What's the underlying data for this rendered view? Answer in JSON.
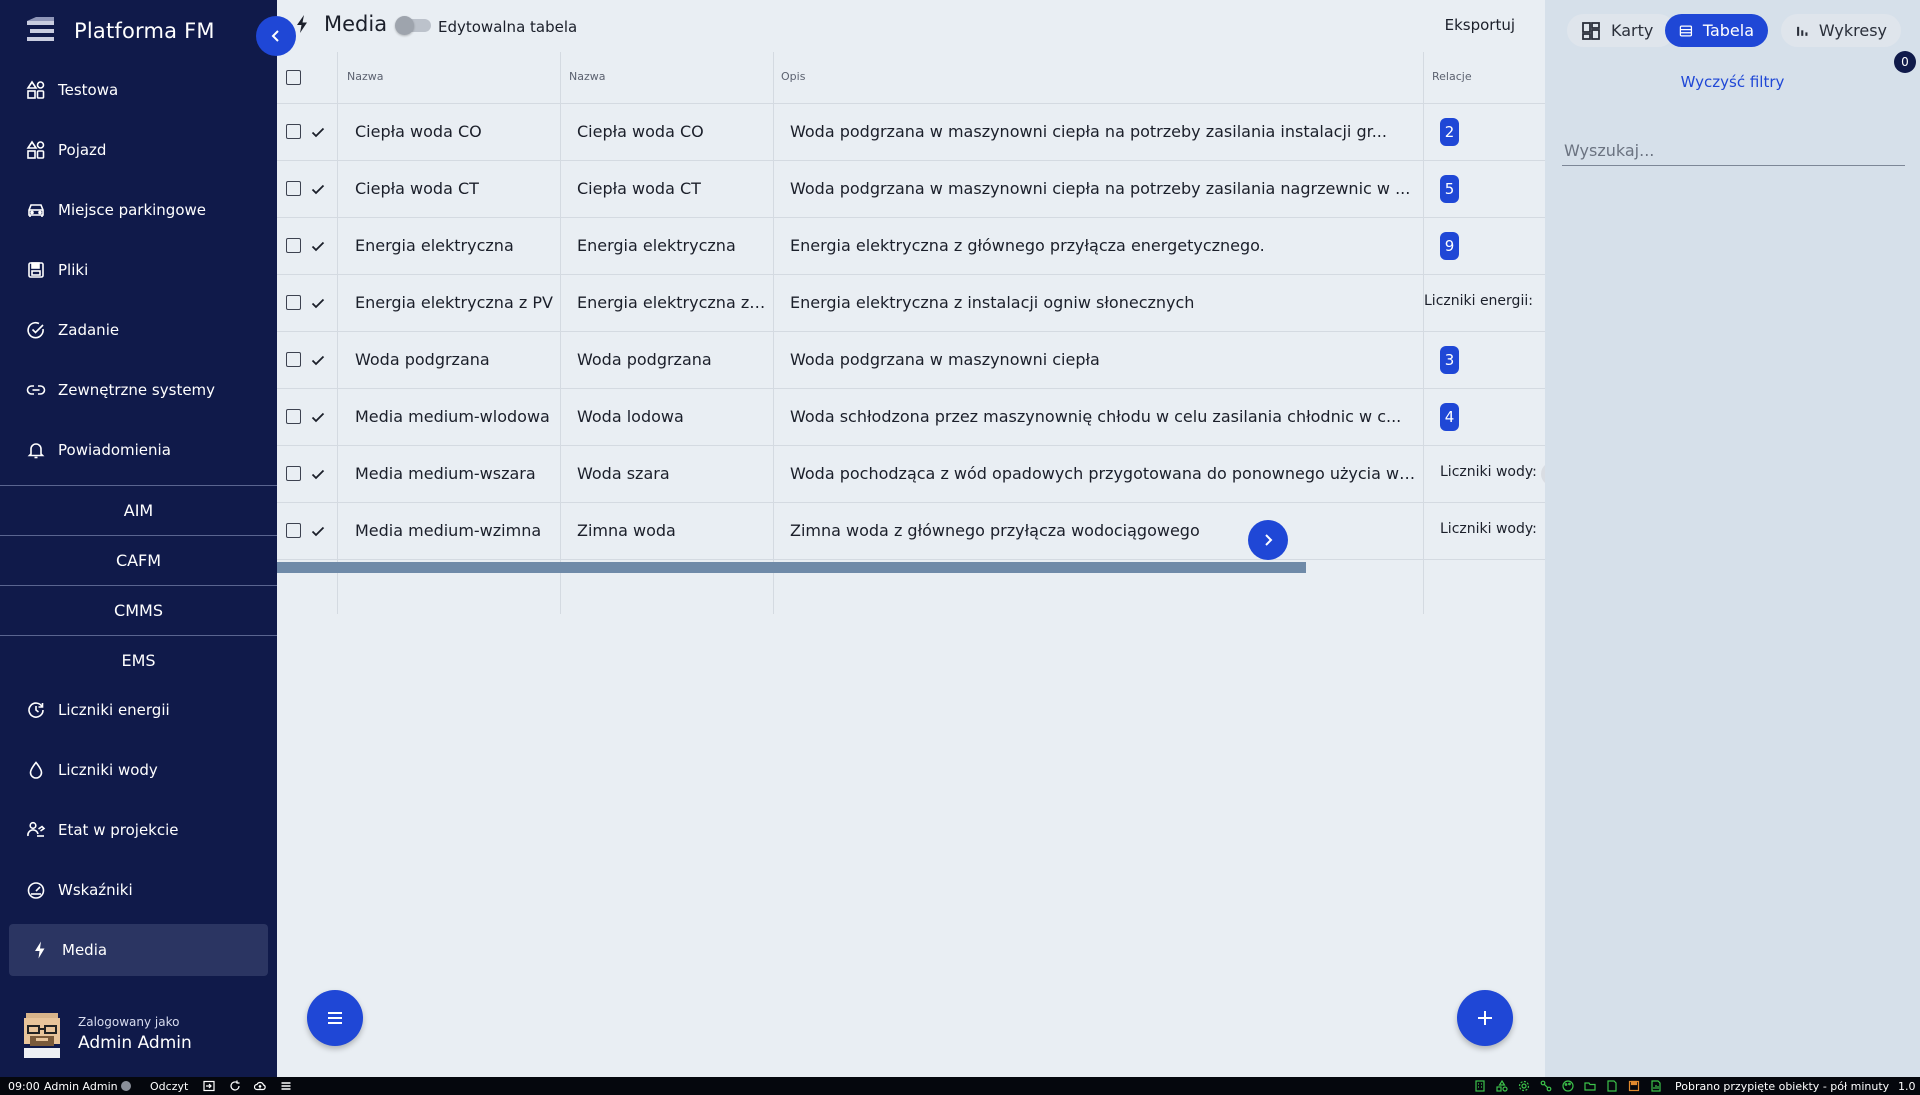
{
  "app": {
    "title": "Platforma FM"
  },
  "sidebar": {
    "items": [
      {
        "label": "Testowa",
        "icon": "shapes-icon"
      },
      {
        "label": "Pojazd",
        "icon": "shapes-icon"
      },
      {
        "label": "Miejsce parkingowe",
        "icon": "car-icon"
      },
      {
        "label": "Pliki",
        "icon": "save-file-icon"
      },
      {
        "label": "Zadanie",
        "icon": "check-circle-icon"
      },
      {
        "label": "Zewnętrzne systemy",
        "icon": "link-icon"
      },
      {
        "label": "Powiadomienia",
        "icon": "bell-icon"
      }
    ],
    "sections": [
      "AIM",
      "CAFM",
      "CMMS",
      "EMS"
    ],
    "ems_items": [
      {
        "label": "Liczniki energii",
        "icon": "gauge-refresh-icon"
      },
      {
        "label": "Liczniki wody",
        "icon": "water-drop-icon"
      },
      {
        "label": "Etat w projekcie",
        "icon": "person-hand-icon"
      },
      {
        "label": "Wskaźniki",
        "icon": "speedometer-icon"
      },
      {
        "label": "Media",
        "icon": "bolt-icon",
        "active": true
      }
    ],
    "user": {
      "caption": "Zalogowany jako",
      "name": "Admin Admin"
    }
  },
  "header": {
    "title": "Media",
    "editable_label": "Edytowalna tabela",
    "editable_on": false,
    "export_label": "Eksportuj"
  },
  "table": {
    "columns": [
      "Nazwa",
      "Nazwa",
      "Opis",
      "Relacje"
    ],
    "rows": [
      {
        "name1": "Ciepła woda CO",
        "name2": "Ciepła woda CO",
        "desc": "Woda podgrzana w maszynowni ciepła na potrzeby zasilania instalacji gr...",
        "relation": "2",
        "relation_type": "badge"
      },
      {
        "name1": "Ciepła woda CT",
        "name2": "Ciepła woda CT",
        "desc": "Woda podgrzana w maszynowni ciepła na potrzeby zasilania nagrzewnic w ...",
        "relation": "5",
        "relation_type": "badge"
      },
      {
        "name1": "Energia elektryczna",
        "name2": "Energia elektryczna",
        "desc": "Energia elektryczna z głównego przyłącza energetycznego.",
        "relation": "9",
        "relation_type": "badge"
      },
      {
        "name1": "Energia elektryczna z PV",
        "name2": "Energia elektryczna z PV",
        "desc": "Energia elektryczna z instalacji ogniw słonecznych",
        "relation": "Liczniki energii:",
        "relation_type": "text"
      },
      {
        "name1": "Woda podgrzana",
        "name2": "Woda podgrzana",
        "desc": "Woda podgrzana w maszynowni ciepła",
        "relation": "3",
        "relation_type": "badge"
      },
      {
        "name1": "Media medium-wlodowa",
        "name2": "Woda lodowa",
        "desc": "Woda schłodzona przez maszynownię chłodu w celu zasilania chłodnic w c...",
        "relation": "4",
        "relation_type": "badge"
      },
      {
        "name1": "Media medium-wszara",
        "name2": "Woda szara",
        "desc": "Woda pochodząca z wód opadowych przygotowana do ponownego użycia w sta...",
        "relation": "Liczniki wody:",
        "relation_type": "text",
        "chip": "L"
      },
      {
        "name1": "Media medium-wzimna",
        "name2": "Zimna woda",
        "desc": "Zimna woda z głównego przyłącza wodociągowego",
        "relation": "Liczniki wody:",
        "relation_type": "text"
      }
    ]
  },
  "view_switch": {
    "cards": "Karty",
    "table": "Tabela",
    "charts": "Wykresy",
    "selected": "Tabela"
  },
  "filters": {
    "count": "0",
    "clear_label": "Wyczyść filtry",
    "search_placeholder": "Wyszukaj..."
  },
  "status_bar": {
    "time": "09:00",
    "user": "Admin Admin",
    "mode": "Odczyt",
    "message": "Pobrano przypięte obiekty - pół minuty temu",
    "version": "1.0"
  },
  "colors": {
    "sidebar": "#101a4a",
    "accent": "#1f47d6",
    "panel": "#d6e0ea",
    "background": "#e9eef3"
  }
}
